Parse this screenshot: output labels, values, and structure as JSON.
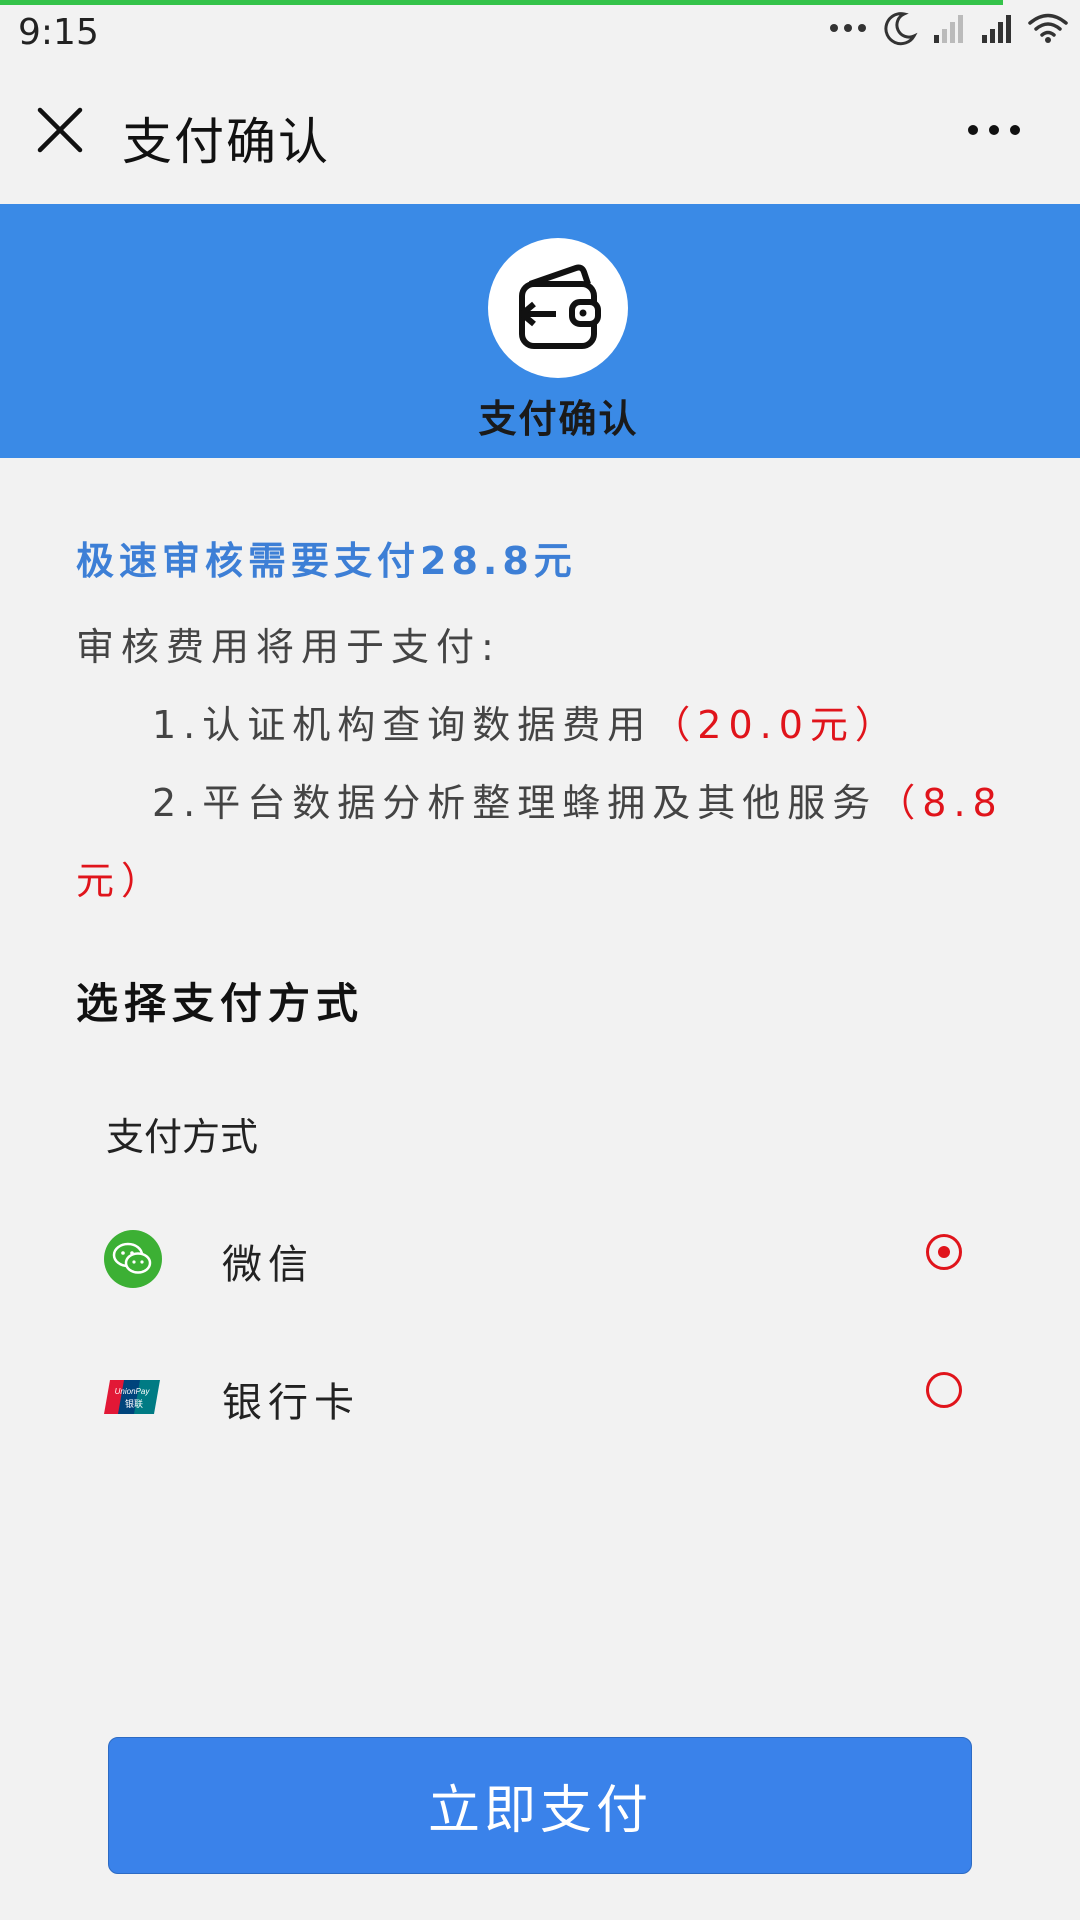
{
  "status_bar": {
    "time": "9:15",
    "icons": [
      "more-dots-icon",
      "moon-icon",
      "signal-weak-icon",
      "signal-icon",
      "wifi-icon"
    ]
  },
  "navbar": {
    "title": "支付确认",
    "close_icon": "close-icon",
    "more_icon": "more-icon"
  },
  "banner": {
    "icon": "wallet-icon",
    "title": "支付确认",
    "color": "#3a8ae6"
  },
  "content": {
    "headline": "极速审核需要支付28.8元",
    "intro": "审核费用将用于支付:",
    "items": [
      {
        "text": "1.认证机构查询数据费用",
        "amount": "（20.0元）"
      },
      {
        "text": "2.平台数据分析整理蜂拥及其他服务",
        "amount_part1": "（8.8",
        "amount_part2": "元）"
      }
    ],
    "accent_color": "#3d7fd6",
    "amount_color": "#e0141b"
  },
  "payment": {
    "section_title": "选择支付方式",
    "subtitle": "支付方式",
    "options": [
      {
        "label": "微信",
        "icon": "wechat-icon",
        "selected": true
      },
      {
        "label": "银行卡",
        "icon": "unionpay-icon",
        "selected": false
      }
    ],
    "unionpay_logo_text": "UnionPay 银联"
  },
  "button": {
    "label": "立即支付",
    "color": "#3a82ea"
  }
}
